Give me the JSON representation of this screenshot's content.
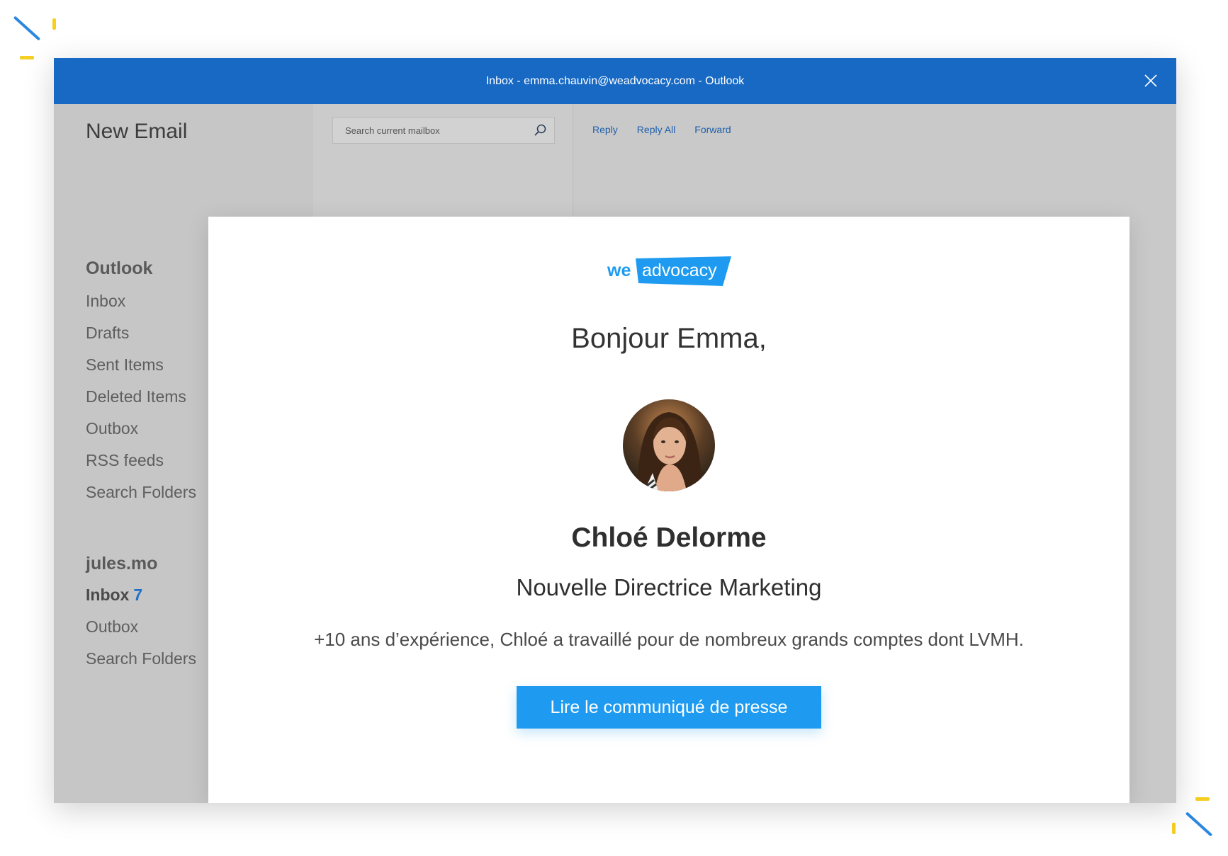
{
  "colors": {
    "titlebar": "#1769c4",
    "accent": "#1e9bf0",
    "link": "#1f5fab",
    "spark_blue": "#2b87e0",
    "spark_yellow": "#f6cf22"
  },
  "window": {
    "title": "Inbox - emma.chauvin@weadvocacy.com - Outlook",
    "close_icon": "close-icon"
  },
  "sidebar": {
    "new_email": "New Email",
    "group1": {
      "title": "Outlook",
      "items": [
        "Inbox",
        "Drafts",
        "Sent Items",
        "Deleted Items",
        "Outbox",
        "RSS feeds",
        "Search Folders"
      ]
    },
    "group2": {
      "title": "jules.mo",
      "inbox_label": "Inbox",
      "inbox_count": "7",
      "items": [
        "Outbox",
        "Search Folders"
      ]
    }
  },
  "search": {
    "placeholder": "Search current mailbox",
    "icon": "search-icon"
  },
  "actions": {
    "reply": "Reply",
    "reply_all": "Reply All",
    "forward": "Forward"
  },
  "email": {
    "logo_we": "we",
    "logo_advocacy": "advocacy",
    "greeting": "Bonjour Emma,",
    "person_name": "Chloé Delorme",
    "person_role": "Nouvelle Directrice Marketing",
    "person_desc": "+10 ans d’expérience, Chloé a travaillé pour de nombreux grands comptes dont LVMH.",
    "cta_label": "Lire le communiqué de presse"
  }
}
